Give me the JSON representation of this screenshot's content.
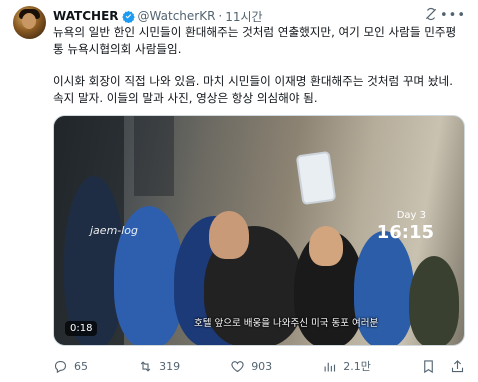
{
  "author": {
    "name": "WATCHER",
    "handle": "@WatcherKR",
    "separator": "·",
    "time": "11시간"
  },
  "post": {
    "paragraph1": "뉴욕의 일반 한인 시민들이 환대해주는 것처럼 연출했지만, 여기 모인 사람들 민주평통 뉴욕시협의회 사람들임.",
    "paragraph2": "이시화 회장이 직접 나와 있음. 마치 시민들이 이재명 환대해주는 것처럼 꾸며 놨네. 속지 말자. 이들의 말과 사진, 영상은 항상 의심해야 됨."
  },
  "video": {
    "sign": "jaem-log",
    "day": "Day 3",
    "time": "16:15",
    "subtitle": "호텔 앞으로 배웅을 나와주신 미국 동포 여러분",
    "duration": "0:18"
  },
  "actions": {
    "replies": "65",
    "reposts": "319",
    "likes": "903",
    "views": "2.1만"
  },
  "colors": {
    "text": "#0f1419",
    "muted": "#536471",
    "verified": "#1d9bf0"
  }
}
